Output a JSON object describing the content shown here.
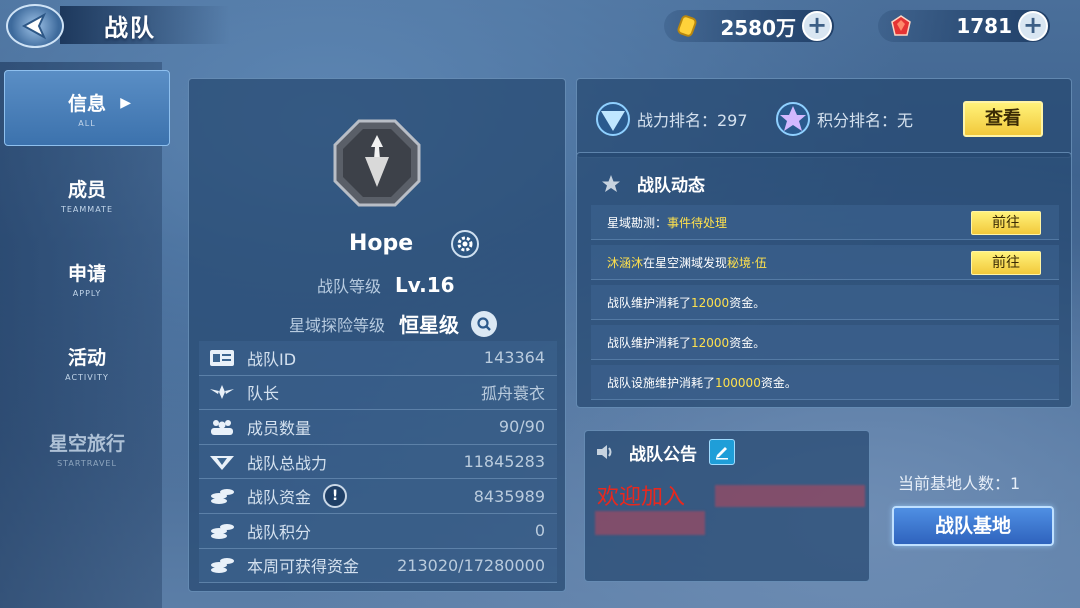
{
  "header": {
    "title": "战队",
    "gold_value": "2580万",
    "gem_value": "1781",
    "plus_label": "+"
  },
  "sidebar": {
    "items": [
      {
        "label": "信息",
        "sub": "ALL",
        "active": true
      },
      {
        "label": "成员",
        "sub": "TEAMMATE"
      },
      {
        "label": "申请",
        "sub": "APPLY"
      },
      {
        "label": "活动",
        "sub": "ACTIVITY"
      },
      {
        "label": "星空旅行",
        "sub": "STARTRAVEL"
      }
    ]
  },
  "team": {
    "name": "Hope",
    "level_label": "战队等级",
    "level_value": "Lv.16",
    "explore_label": "星域探险等级",
    "explore_value": "恒星级",
    "stats": [
      {
        "label": "战队ID",
        "value": "143364"
      },
      {
        "label": "队长",
        "value": "孤舟蓑衣"
      },
      {
        "label": "成员数量",
        "value": "90/90"
      },
      {
        "label": "战队总战力",
        "value": "11845283"
      },
      {
        "label": "战队资金",
        "value": "8435989"
      },
      {
        "label": "战队积分",
        "value": "0"
      },
      {
        "label": "本周可获得资金",
        "value": "213020/17280000"
      }
    ],
    "warn_label": "!"
  },
  "rank": {
    "power_rank": "战力排名：297",
    "score_rank": "积分排名：无",
    "view_button": "查看"
  },
  "news": {
    "title": "战队动态",
    "go_label": "前往",
    "rows": [
      {
        "pre": "星域勘测：",
        "hl": "事件待处理",
        "post": ""
      },
      {
        "pre": "",
        "hl": "沐涵沐",
        "post": "在星空渊域发现",
        "hl2": "秘境·伍"
      },
      {
        "pre": "战队维护消耗了",
        "hl": "12000",
        "post": "资金。"
      },
      {
        "pre": "战队维护消耗了",
        "hl": "12000",
        "post": "资金。"
      },
      {
        "pre": "战队设施维护消耗了",
        "hl": "100000",
        "post": "资金。"
      }
    ]
  },
  "notice": {
    "title": "战队公告",
    "text": "欢迎加入"
  },
  "base": {
    "info": "当前基地人数：1",
    "button": "战队基地"
  },
  "colors": {
    "accent_yellow": "#f2c93b",
    "highlight": "#ffe14d",
    "notice_red": "#e8281e",
    "base_blue": "#2f63bd"
  }
}
